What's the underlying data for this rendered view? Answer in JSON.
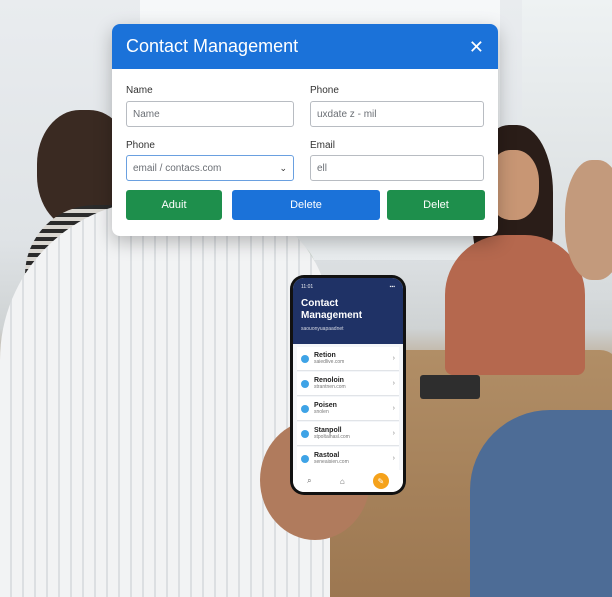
{
  "dialog": {
    "title": "Contact Management",
    "close_icon": "close-icon",
    "fields": [
      {
        "label": "Name",
        "placeholder": "Name"
      },
      {
        "label": "Phone",
        "placeholder": "uxdate z - mil"
      },
      {
        "label": "Phone",
        "value": "email / contacs.com"
      },
      {
        "label": "Email",
        "placeholder": "ell"
      }
    ],
    "buttons": {
      "add": "Aduit",
      "delete": "Delete",
      "delete2": "Delet"
    },
    "colors": {
      "header": "#1b72d9",
      "green": "#1e8f4c",
      "blue": "#1b72d9"
    }
  },
  "phone": {
    "status_time": "11:01",
    "title": "Contact Management",
    "subtitle": "saouonyuapaadnet",
    "contacts": [
      {
        "name": "Retion",
        "email": "saiedlive.com"
      },
      {
        "name": "Renoloin",
        "email": "strantnen.com"
      },
      {
        "name": "Poisen",
        "email": "snolen"
      },
      {
        "name": "Stanpoll",
        "email": "stpoltalhasl.com"
      },
      {
        "name": "Rastoal",
        "email": "seneaisien.com"
      }
    ],
    "fab_color": "#f5a21b"
  }
}
